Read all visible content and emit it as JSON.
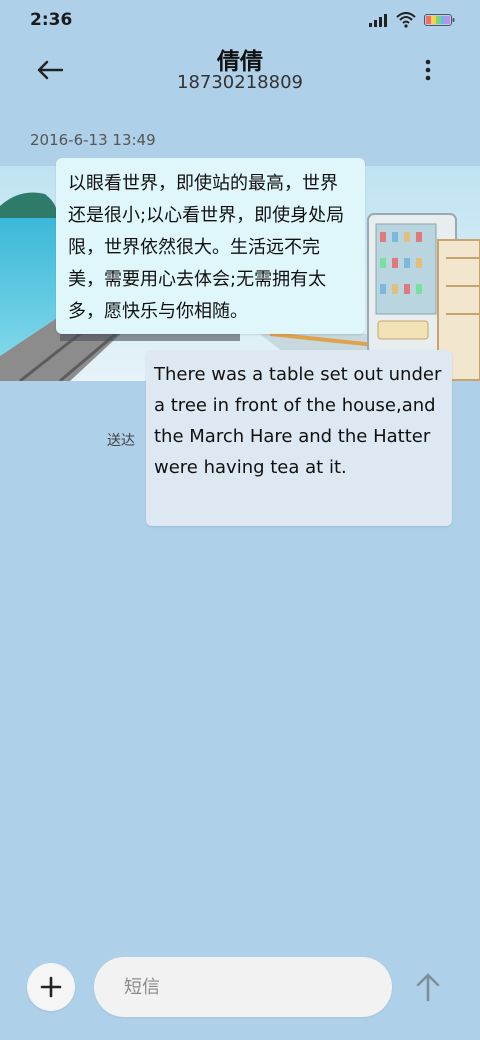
{
  "status_bar": {
    "time": "2:36",
    "icons": [
      "signal-icon",
      "wifi-icon",
      "battery-icon"
    ]
  },
  "header": {
    "contact_name": "倩倩",
    "phone_number": "18730218809",
    "icons": [
      "back-arrow-icon",
      "more-vert-icon"
    ]
  },
  "conversation": {
    "timestamp": "2016-6-13 13:49",
    "incoming_message": "以眼看世界，即使站的最高，世界还是很小;以心看世界，即使身处局限，世界依然很大。生活远不完美，需要用心去体会;无需拥有太多，愿快乐与你相随。",
    "outgoing_message": "There was a table set out under a tree in front of the house,and the March Hare and the Hatter were having tea at it.",
    "outgoing_status": "送达"
  },
  "composer": {
    "placeholder": "短信",
    "value": "",
    "icons": [
      "plus-icon",
      "send-arrow-icon"
    ]
  },
  "colors": {
    "background": "#aed0e8",
    "incoming_bubble": "#dff6fb",
    "outgoing_bubble": "#dde8f2",
    "input_bg": "#f2f2f2"
  }
}
